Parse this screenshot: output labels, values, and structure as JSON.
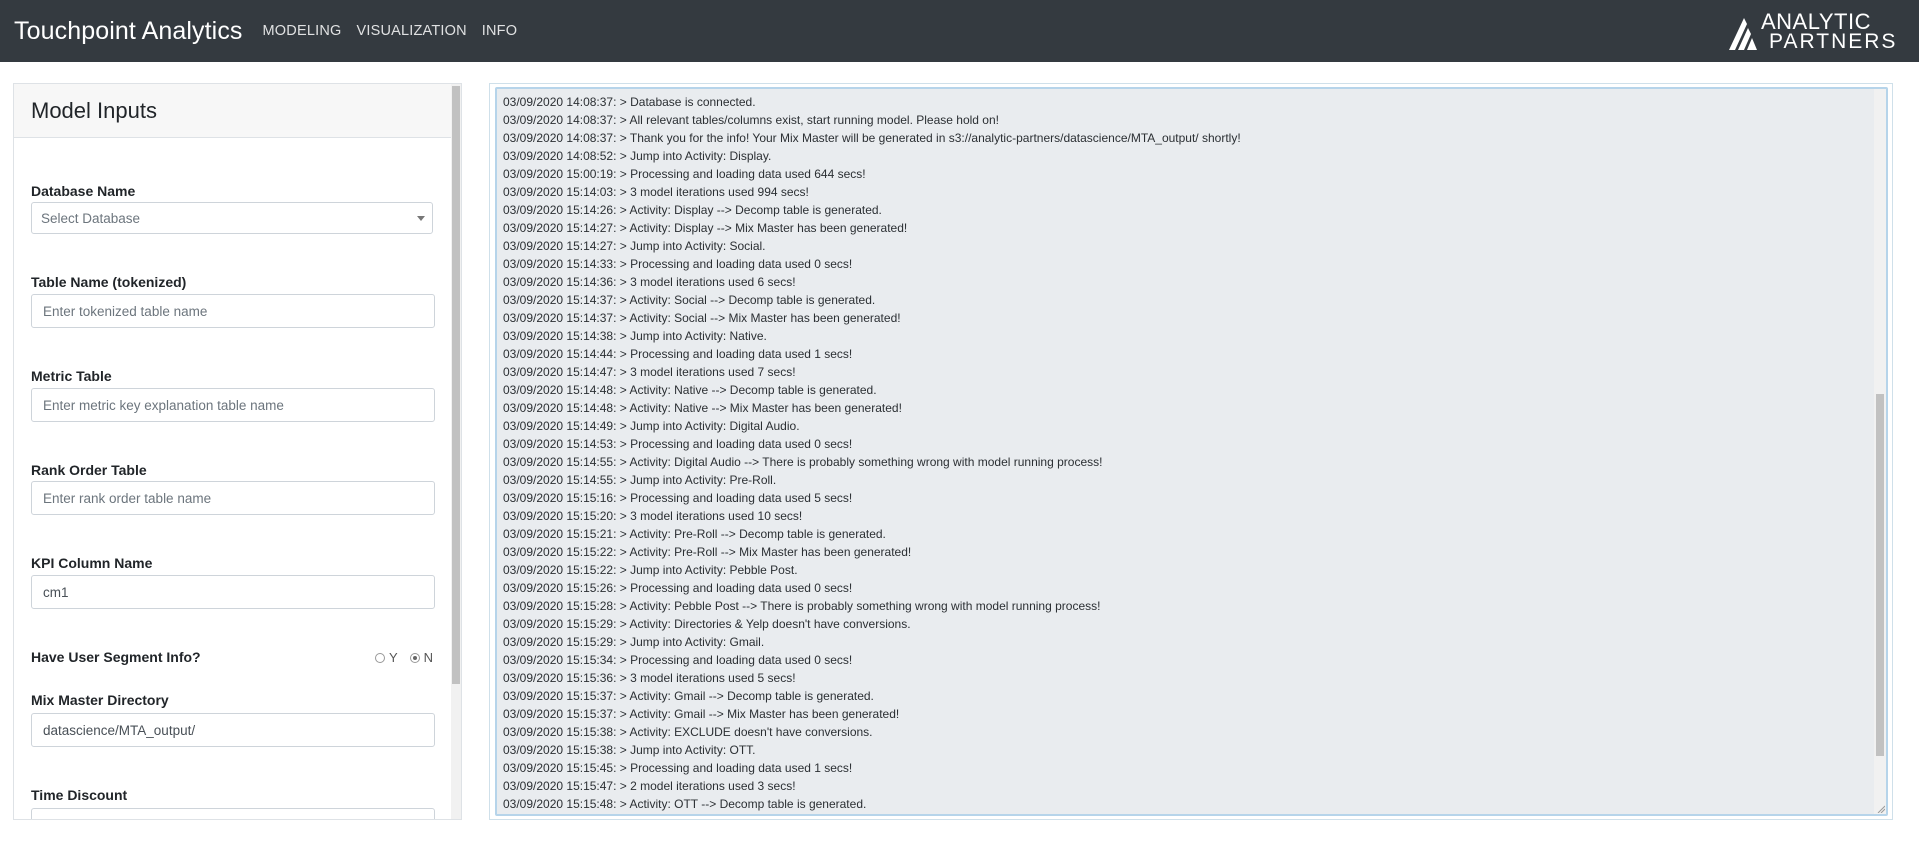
{
  "navbar": {
    "brand": "Touchpoint Analytics",
    "links": [
      "MODELING",
      "VISUALIZATION",
      "INFO"
    ],
    "logo_line1": "ANALYTIC",
    "logo_line2": "PARTNERS"
  },
  "left_panel": {
    "title": "Model Inputs",
    "database": {
      "label": "Database Name",
      "placeholder": "Select Database"
    },
    "table_name": {
      "label": "Table Name (tokenized)",
      "placeholder": "Enter tokenized table name"
    },
    "metric_table": {
      "label": "Metric Table",
      "placeholder": "Enter metric key explanation table name"
    },
    "rank_order": {
      "label": "Rank Order Table",
      "placeholder": "Enter rank order table name"
    },
    "kpi": {
      "label": "KPI Column Name",
      "value": "cm1"
    },
    "segment": {
      "label": "Have User Segment Info?",
      "option_y": "Y",
      "option_n": "N",
      "selected": "N"
    },
    "mix_master": {
      "label": "Mix Master Directory",
      "value": "datascience/MTA_output/"
    },
    "time_discount": {
      "label": "Time Discount"
    }
  },
  "log": {
    "lines": [
      "03/09/2020 14:08:37: > Database is connected.",
      "03/09/2020 14:08:37: > All relevant tables/columns exist, start running model. Please hold on!",
      "03/09/2020 14:08:37: > Thank you for the info! Your Mix Master will be generated in s3://analytic-partners/datascience/MTA_output/ shortly!",
      "03/09/2020 14:08:52: > Jump into Activity: Display.",
      "03/09/2020 15:00:19: > Processing and loading data used 644 secs!",
      "03/09/2020 15:14:03: > 3 model iterations used 994 secs!",
      "03/09/2020 15:14:26: > Activity: Display --> Decomp table is generated.",
      "03/09/2020 15:14:27: > Activity: Display --> Mix Master has been generated!",
      "03/09/2020 15:14:27: > Jump into Activity: Social.",
      "03/09/2020 15:14:33: > Processing and loading data used 0 secs!",
      "03/09/2020 15:14:36: > 3 model iterations used 6 secs!",
      "03/09/2020 15:14:37: > Activity: Social --> Decomp table is generated.",
      "03/09/2020 15:14:37: > Activity: Social --> Mix Master has been generated!",
      "03/09/2020 15:14:38: > Jump into Activity: Native.",
      "03/09/2020 15:14:44: > Processing and loading data used 1 secs!",
      "03/09/2020 15:14:47: > 3 model iterations used 7 secs!",
      "03/09/2020 15:14:48: > Activity: Native --> Decomp table is generated.",
      "03/09/2020 15:14:48: > Activity: Native --> Mix Master has been generated!",
      "03/09/2020 15:14:49: > Jump into Activity: Digital Audio.",
      "03/09/2020 15:14:53: > Processing and loading data used 0 secs!",
      "03/09/2020 15:14:55: > Activity: Digital Audio --> There is probably something wrong with model running process!",
      "03/09/2020 15:14:55: > Jump into Activity: Pre-Roll.",
      "03/09/2020 15:15:16: > Processing and loading data used 5 secs!",
      "03/09/2020 15:15:20: > 3 model iterations used 10 secs!",
      "03/09/2020 15:15:21: > Activity: Pre-Roll --> Decomp table is generated.",
      "03/09/2020 15:15:22: > Activity: Pre-Roll --> Mix Master has been generated!",
      "03/09/2020 15:15:22: > Jump into Activity: Pebble Post.",
      "03/09/2020 15:15:26: > Processing and loading data used 0 secs!",
      "03/09/2020 15:15:28: > Activity: Pebble Post --> There is probably something wrong with model running process!",
      "03/09/2020 15:15:29: > Activity: Directories & Yelp doesn't have conversions.",
      "03/09/2020 15:15:29: > Jump into Activity: Gmail.",
      "03/09/2020 15:15:34: > Processing and loading data used 0 secs!",
      "03/09/2020 15:15:36: > 3 model iterations used 5 secs!",
      "03/09/2020 15:15:37: > Activity: Gmail --> Decomp table is generated.",
      "03/09/2020 15:15:37: > Activity: Gmail --> Mix Master has been generated!",
      "03/09/2020 15:15:38: > Activity: EXCLUDE doesn't have conversions.",
      "03/09/2020 15:15:38: > Jump into Activity: OTT.",
      "03/09/2020 15:15:45: > Processing and loading data used 1 secs!",
      "03/09/2020 15:15:47: > 2 model iterations used 3 secs!",
      "03/09/2020 15:15:48: > Activity: OTT --> Decomp table is generated."
    ]
  }
}
